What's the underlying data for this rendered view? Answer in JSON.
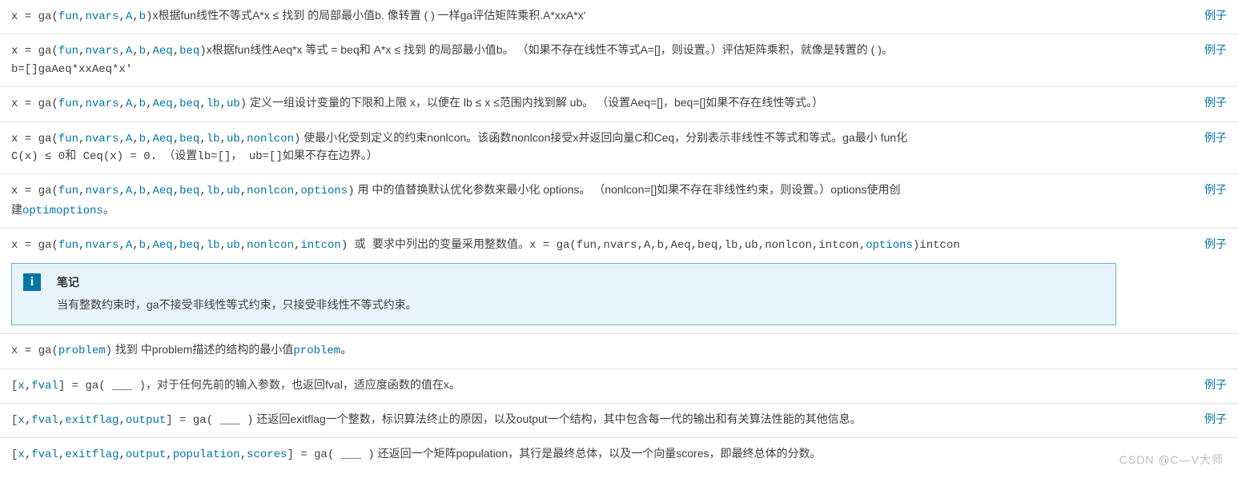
{
  "exampleLabel": "例子",
  "watermark": "CSDN @C—V大师",
  "note": {
    "iconGlyph": "i",
    "title": "笔记",
    "body": "当有整数约束时，ga不接受非线性等式约束，只接受非线性不等式约束。"
  },
  "rows": {
    "r1": {
      "lead": "x = ga(",
      "args": [
        "fun",
        "nvars",
        "A",
        "b"
      ],
      "trail": ")",
      "desc_a": "x根据fun线性不等式A*x ≤  找到 的局部最小值b. 像转置 ( ) 一样ga评估矩阵乘积.A*xxA*x'"
    },
    "r2": {
      "lead": "x = ga(",
      "args": [
        "fun",
        "nvars",
        "A",
        "b",
        "Aeq",
        "beq"
      ],
      "trail": ")",
      "desc_a": "x根据fun线性Aeq*x 等式 = beq和 A*x ≤  找到 的局部最小值b。 （如果不存在线性不等式A=[]，则设置。）评估矩阵乘积，就像是转置的 ( )。",
      "desc_b": "b=[]gaAeq*xxAeq*x'"
    },
    "r3": {
      "lead": "x = ga(",
      "args": [
        "fun",
        "nvars",
        "A",
        "b",
        "Aeq",
        "beq",
        "lb",
        "ub"
      ],
      "trail": ")",
      "desc_a": " 定义一组设计变量的下限和上限 x，以便在 lb ≤  x ≤范围内找到解 ub。 （设置Aeq=[]，beq=[]如果不存在线性等式。）"
    },
    "r4": {
      "lead": "x = ga(",
      "args": [
        "fun",
        "nvars",
        "A",
        "b",
        "Aeq",
        "beq",
        "lb",
        "ub",
        "nonlcon"
      ],
      "trail": ")",
      "desc_a": " 使最小化受到定义的约束nonlcon。该函数nonlcon接受x并返回向量C和Ceq，分别表示非线性不等式和等式。ga最小 fun化",
      "desc_b": "C(x) ≤ 0和 Ceq(x) = 0. （设置lb=[]， ub=[]如果不存在边界。）"
    },
    "r5": {
      "lead": "x = ga(",
      "args": [
        "fun",
        "nvars",
        "A",
        "b",
        "Aeq",
        "beq",
        "lb",
        "ub",
        "nonlcon",
        "options"
      ],
      "trail": ")",
      "desc_a": " 用 中的值替换默认优化参数来最小化 options。 （nonlcon=[]如果不存在非线性约束，则设置。）options使用创",
      "desc_b_pre": "建",
      "link": "optimoptions",
      "desc_b_post": "。"
    },
    "r6": {
      "lead": "x = ga(",
      "args": [
        "fun",
        "nvars",
        "A",
        "b",
        "Aeq",
        "beq",
        "lb",
        "ub",
        "nonlcon",
        "intcon"
      ],
      "trail": ")",
      "desc_a": " 或 要求中列出的变量采用整数值。x = ga(fun,nvars,A,b,Aeq,beq,lb,ub,nonlcon,intcon,",
      "link2": "options",
      "desc_a2": ")intcon"
    },
    "r7": {
      "lead": "x = ga(",
      "args": [
        "problem"
      ],
      "trail": ")",
      "desc_a": " 找到 中problem描述的结构的最小值",
      "link": "problem",
      "desc_a2": "。"
    },
    "r8": {
      "outLead": "[",
      "outArgs": [
        "x",
        "fval"
      ],
      "outTrail": "] = ga( ___ )",
      "desc_a": "，对于任何先前的输入参数，也返回fval，适应度函数的值在x。"
    },
    "r9": {
      "outLead": "[",
      "outArgs": [
        "x",
        "fval",
        "exitflag",
        "output"
      ],
      "outTrail": "] = ga( ___ )",
      "desc_a": " 还返回exitflag一个整数，标识算法终止的原因，以及output一个结构，其中包含每一代的输出和有关算法性能的其他信息。"
    },
    "r10": {
      "outLead": "[",
      "outArgs": [
        "x",
        "fval",
        "exitflag",
        "output",
        "population",
        "scores"
      ],
      "outTrail": "] = ga( ___ )",
      "desc_a": " 还返回一个矩阵population，其行是最终总体，以及一个向量scores，即最终总体的分数。"
    }
  }
}
